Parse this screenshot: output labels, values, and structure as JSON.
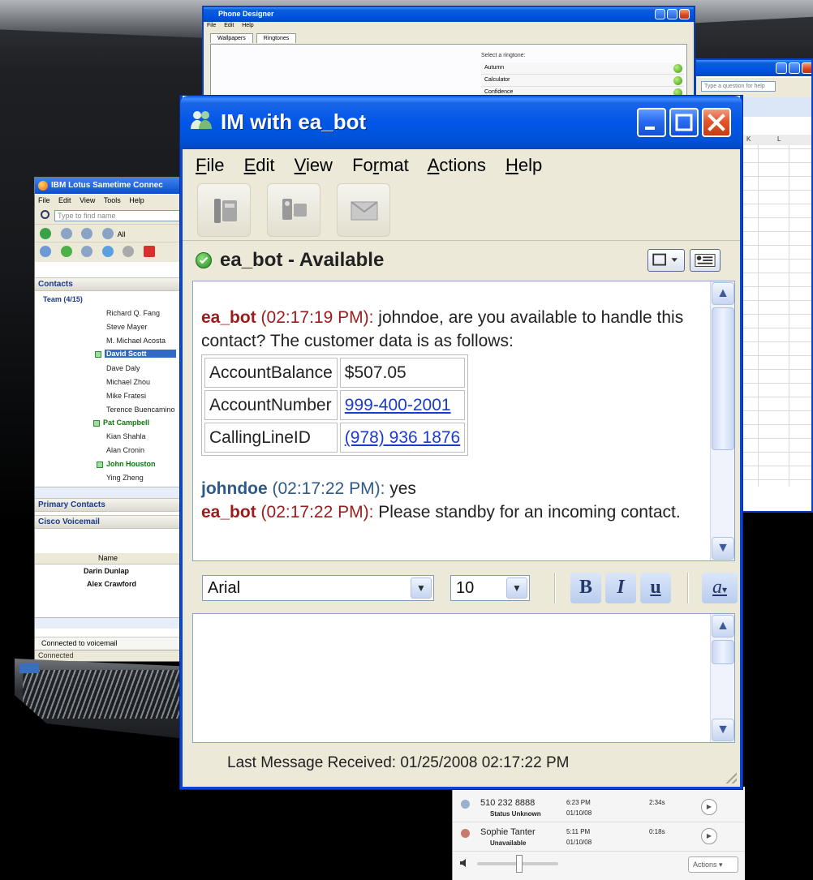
{
  "phone_designer": {
    "title": "Phone Designer",
    "menu": [
      "File",
      "Edit",
      "Help"
    ],
    "tabs": [
      "Wallpapers",
      "Ringtones"
    ],
    "ringtone_label": "Select a ringtone:",
    "ringtones": [
      "Autumn",
      "Calculator",
      "Confidence"
    ]
  },
  "excel": {
    "help_placeholder": "Type a question for help",
    "columns": [
      "K",
      "L"
    ]
  },
  "sametime": {
    "title": "IBM Lotus Sametime Connec",
    "menu": [
      "File",
      "Edit",
      "View",
      "Tools",
      "Help"
    ],
    "find_placeholder": "Type to find name",
    "filter_label": "All",
    "contacts_header": "Contacts",
    "team_label": "Team (4/15)",
    "contacts": [
      {
        "name": "Richard Q. Fang",
        "style": "normal"
      },
      {
        "name": "Steve Mayer",
        "style": "normal"
      },
      {
        "name": "M. Michael Acosta",
        "style": "normal"
      },
      {
        "name": "David Scott",
        "style": "selected"
      },
      {
        "name": "Dave Daly",
        "style": "normal"
      },
      {
        "name": "Michael Zhou",
        "style": "normal"
      },
      {
        "name": "Mike Fratesi",
        "style": "normal"
      },
      {
        "name": "Terence Buencamino",
        "style": "normal"
      },
      {
        "name": "Pat Campbell",
        "style": "green"
      },
      {
        "name": "Kian Shahla",
        "style": "normal"
      },
      {
        "name": "Alan Cronin",
        "style": "normal"
      },
      {
        "name": "John Houston",
        "style": "green"
      },
      {
        "name": "Ying Zheng",
        "style": "normal"
      }
    ],
    "primary_contacts": "Primary Contacts",
    "voicemail_header": "Cisco Voicemail",
    "vm_column": "Name",
    "vm_rows": [
      "Darin Dunlap",
      "Alex Crawford"
    ],
    "vm_status": "Connected to voicemail",
    "status": "Connected"
  },
  "im": {
    "title": "IM with ea_bot",
    "menu": [
      {
        "label": "File"
      },
      {
        "label": "Edit"
      },
      {
        "label": "View"
      },
      {
        "label": "Format"
      },
      {
        "label": "Actions"
      },
      {
        "label": "Help"
      }
    ],
    "status_text": "ea_bot - Available",
    "messages": [
      {
        "sender": "ea_bot",
        "time": "(02:17:19 PM):",
        "text": "johndoe, are you available to handle this contact? The customer data is as follows:"
      },
      {
        "sender": "johndoe",
        "time": "(02:17:22 PM):",
        "text": "yes"
      },
      {
        "sender": "ea_bot",
        "time": "(02:17:22 PM):",
        "text": "Please standby for an incoming contact."
      }
    ],
    "customer_data": [
      {
        "key": "AccountBalance",
        "value": "$507.05",
        "link": false
      },
      {
        "key": "AccountNumber",
        "value": "999-400-2001",
        "link": true
      },
      {
        "key": "CallingLineID",
        "value": "(978) 936 1876",
        "link": true
      }
    ],
    "font_name": "Arial",
    "font_size": "10",
    "bold_label": "B",
    "italic_label": "I",
    "underline_label": "u",
    "color_label": "a",
    "last_message": "Last Message Received: 01/25/2008 02:17:22 PM"
  },
  "softphone": {
    "calls": [
      {
        "name": "510 232 8888",
        "status": "Status Unknown",
        "time": "6:23 PM",
        "date": "01/10/08",
        "duration": "2:34s"
      },
      {
        "name": "Sophie Tanter",
        "status": "Unavailable",
        "time": "5:11 PM",
        "date": "01/10/08",
        "duration": "0:18s"
      }
    ],
    "actions_label": "Actions"
  },
  "colors": {
    "xp_blue": "#0054e3",
    "bot_red": "#9b1c1c",
    "user_blue": "#2d5a8a",
    "link_blue": "#1a3bd1"
  }
}
